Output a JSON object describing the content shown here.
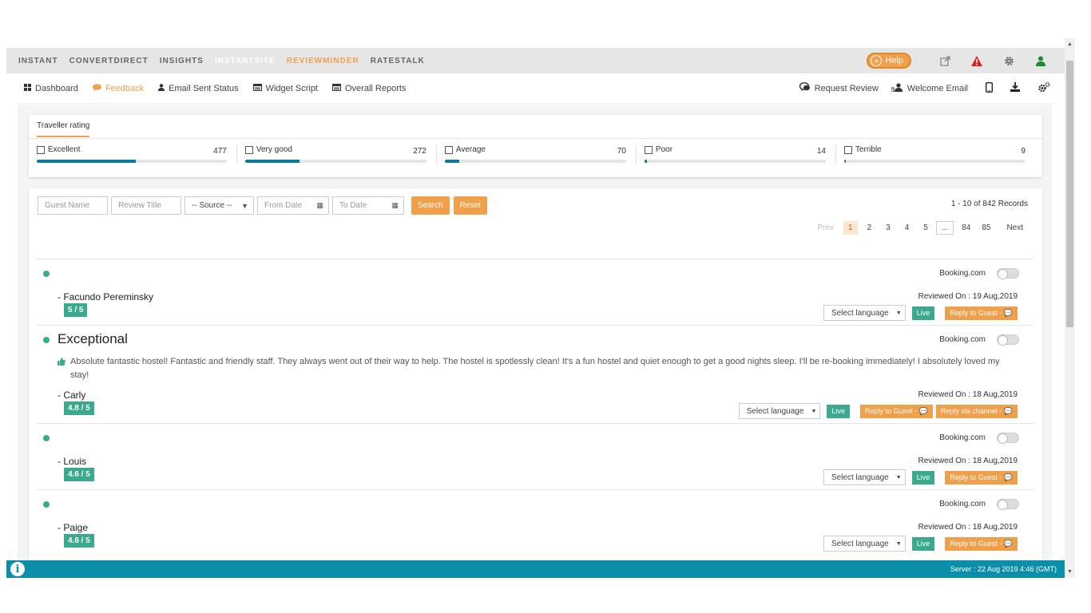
{
  "topnav": {
    "items": [
      "INSTANT",
      "CONVERTDIRECT",
      "INSIGHTS",
      "INSTANTSITE",
      "REVIEWMINDER",
      "RATESTALK"
    ],
    "help_label": "Help"
  },
  "subnav": {
    "left": [
      "Dashboard",
      "Feedback",
      "Email Sent Status",
      "Widget Script",
      "Overall Reports"
    ],
    "right": [
      "Request Review",
      "Welcome Email"
    ]
  },
  "rating": {
    "tab_label": "Traveller rating",
    "items": [
      {
        "label": "Excellent",
        "count": "477",
        "fraction": 0.52
      },
      {
        "label": "Very good",
        "count": "272",
        "fraction": 0.3
      },
      {
        "label": "Average",
        "count": "70",
        "fraction": 0.08
      },
      {
        "label": "Poor",
        "count": "14",
        "fraction": 0.015
      },
      {
        "label": "Terrible",
        "count": "9",
        "fraction": 0.01
      }
    ]
  },
  "filters": {
    "guest_name": "Guest Name",
    "review_title": "Review Title",
    "source": "-- Source --",
    "from_date": "From Date",
    "to_date": "To Date",
    "search": "Search",
    "reset": "Reset"
  },
  "records": "1 - 10 of 842 Records",
  "pager": {
    "prev": "Prev",
    "pages": [
      "1",
      "2",
      "3",
      "4",
      "5",
      "...",
      "84",
      "85"
    ],
    "next": "Next"
  },
  "reviews": [
    {
      "source": "Booking.com",
      "title": "",
      "body": "",
      "name": "- Facundo Pereminsky",
      "score": "5 / 5",
      "reviewed": "Reviewed On : 19 Aug,2019",
      "lang": "Select language",
      "live": "Live",
      "reply": "Reply to Guest -",
      "reply_channel": ""
    },
    {
      "source": "Booking.com",
      "title": "Exceptional",
      "body": "Absolute fantastic hostel! Fantastic and friendly staff. They always went out of their way to help. The hostel is spotlessly clean! It's a fun hostel and quiet enough to get a good nights sleep. I'll be re-booking immediately! I absolutely loved my stay!",
      "name": "- Carly",
      "score": "4.8 / 5",
      "reviewed": "Reviewed On : 18 Aug,2019",
      "lang": "Select language",
      "live": "Live",
      "reply": "Reply to Guest -",
      "reply_channel": "Reply via channel -"
    },
    {
      "source": "Booking.com",
      "title": "",
      "body": "",
      "name": "- Louis",
      "score": "4.6 / 5",
      "reviewed": "Reviewed On : 18 Aug,2019",
      "lang": "Select language",
      "live": "Live",
      "reply": "Reply to Guest -",
      "reply_channel": ""
    },
    {
      "source": "Booking.com",
      "title": "",
      "body": "",
      "name": "- Paige",
      "score": "4.6 / 5",
      "reviewed": "Reviewed On : 18 Aug,2019",
      "lang": "Select language",
      "live": "Live",
      "reply": "Reply to Guest -",
      "reply_channel": ""
    }
  ],
  "footer": {
    "server": "Server : 22 Aug 2019 4:46 (GMT)"
  },
  "colors": {
    "accent": "#f0a04b",
    "teal": "#3aa98e",
    "footer": "#0b8fa8"
  }
}
